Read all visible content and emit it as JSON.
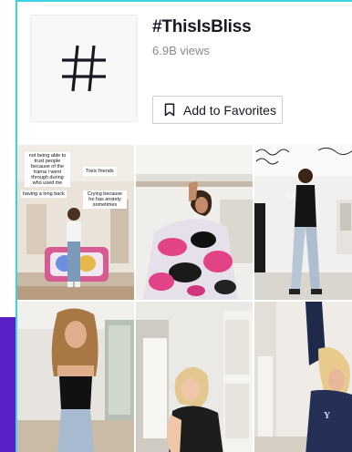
{
  "hashtag": {
    "title": "#ThisIsBliss",
    "views": "6.9B views",
    "favorite_label": "Add to Favorites",
    "symbol_icon": "hashtag-icon",
    "bookmark_icon": "bookmark-icon"
  },
  "videos": [
    {
      "captions": [
        "not being able to trust people because of the trama i went through during who used me",
        "Toxic friends",
        "having a long back",
        "Crying because he has anxiety sometimes"
      ]
    },
    {
      "captions": []
    },
    {
      "captions": []
    },
    {
      "captions": []
    },
    {
      "captions": []
    },
    {
      "captions": []
    }
  ],
  "colors": {
    "accent_border": "#39d5e3",
    "purple": "#5a1fc7",
    "title": "#161823",
    "muted": "#8a8b91"
  }
}
